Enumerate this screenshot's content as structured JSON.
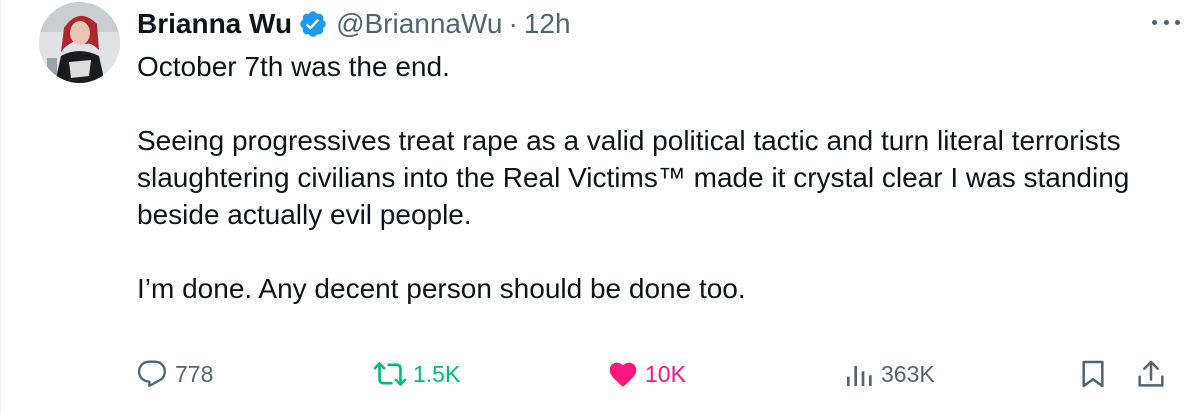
{
  "author": {
    "name": "Brianna Wu",
    "handle": "@BriannaWu",
    "separator": "·",
    "time": "12h",
    "verified": true
  },
  "tweet": {
    "paragraphs": [
      "October 7th was the end.",
      "Seeing progressives treat rape as a valid political tactic and turn literal terrorists slaughtering civilians into the Real Victims™ made it crystal clear I was standing beside actually evil people.",
      "I’m done. Any decent person should be done too."
    ]
  },
  "actions": {
    "reply_count": "778",
    "retweet_count": "1.5K",
    "like_count": "10K",
    "views_count": "363K"
  },
  "colors": {
    "text": "#0f1419",
    "secondary": "#536471",
    "verified": "#1d9bf0",
    "retweet": "#00ba7c",
    "like": "#f91880"
  },
  "icons": [
    "reply-icon",
    "retweet-icon",
    "heart-icon",
    "views-icon",
    "bookmark-icon",
    "share-icon",
    "more-icon",
    "verified-badge-icon"
  ]
}
